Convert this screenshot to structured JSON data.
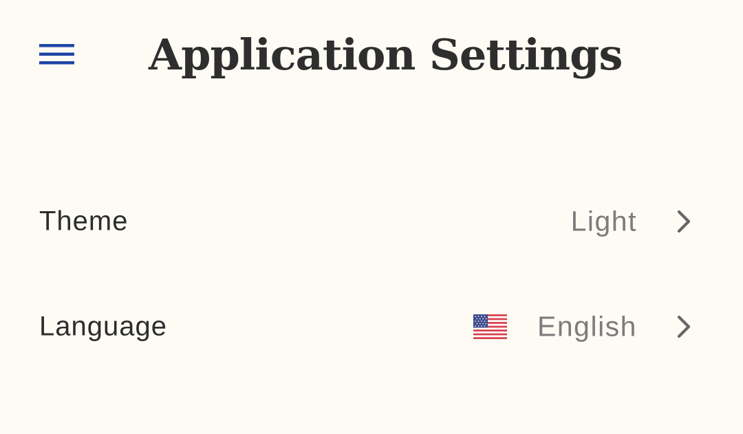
{
  "header": {
    "title": "Application Settings",
    "menu_icon": "hamburger-menu-icon",
    "menu_icon_color": "#1f45a6"
  },
  "settings": [
    {
      "label": "Theme",
      "value": "Light"
    },
    {
      "label": "Language",
      "value": "English",
      "icon": "us-flag-icon"
    }
  ],
  "colors": {
    "background": "#fdfbf4",
    "title": "#2e2e2e",
    "label": "#2d2d2d",
    "value": "#7c7c7c",
    "chevron": "#666666"
  }
}
